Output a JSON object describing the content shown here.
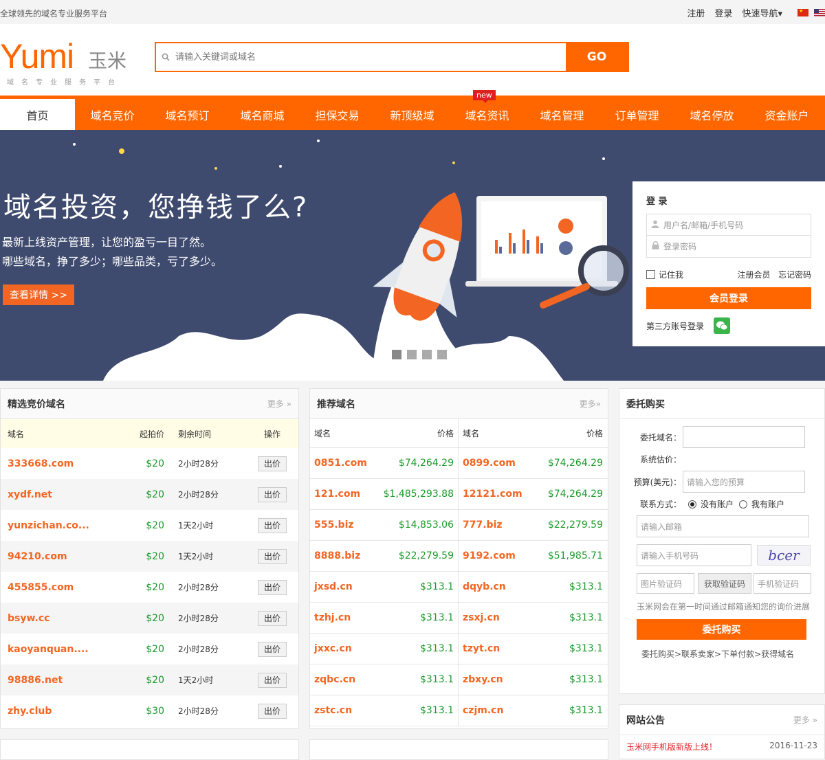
{
  "topbar": {
    "slogan": "全球领先的域名专业服务平台",
    "register": "注册",
    "login": "登录",
    "quicknav": "快速导航"
  },
  "logo": {
    "text": "Yumi",
    "cn": "玉米",
    "sub": "域名专业服务平台"
  },
  "search": {
    "placeholder": "请输入关键词或域名",
    "button": "GO"
  },
  "nav": [
    {
      "label": "首页"
    },
    {
      "label": "域名竞价"
    },
    {
      "label": "域名预订"
    },
    {
      "label": "域名商城"
    },
    {
      "label": "担保交易"
    },
    {
      "label": "新顶级域"
    },
    {
      "label": "域名资讯",
      "tag": "new"
    },
    {
      "label": "域名管理"
    },
    {
      "label": "订单管理"
    },
    {
      "label": "域名停放"
    },
    {
      "label": "资金账户"
    }
  ],
  "banner": {
    "headline": "域名投资，您挣钱了么?",
    "line1": "最新上线资产管理，让您的盈亏一目了然。",
    "line2": "哪些域名，挣了多少；哪些品类，亏了多少。",
    "button": "查看详情 >>"
  },
  "loginbox": {
    "title": "登 录",
    "user_placeholder": "用户名/邮箱/手机号码",
    "pwd_placeholder": "登录密码",
    "remember": "记住我",
    "register": "注册会员",
    "forgot": "忘记密码",
    "submit": "会员登录",
    "third": "第三方账号登录"
  },
  "auction": {
    "title": "精选竞价域名",
    "more": "更多 »",
    "headers": [
      "域名",
      "起拍价",
      "剩余时间",
      "操作"
    ],
    "bid_label": "出价",
    "rows": [
      {
        "name": "333668.com",
        "price": "$20",
        "time": "2小时28分"
      },
      {
        "name": "xydf.net",
        "price": "$20",
        "time": "2小时28分"
      },
      {
        "name": "yunzichan.co...",
        "price": "$20",
        "time": "1天2小时"
      },
      {
        "name": "94210.com",
        "price": "$20",
        "time": "1天2小时"
      },
      {
        "name": "455855.com",
        "price": "$20",
        "time": "2小时28分"
      },
      {
        "name": "bsyw.cc",
        "price": "$20",
        "time": "2小时28分"
      },
      {
        "name": "kaoyanquan....",
        "price": "$20",
        "time": "2小时28分"
      },
      {
        "name": "98886.net",
        "price": "$20",
        "time": "1天2小时"
      },
      {
        "name": "zhy.club",
        "price": "$30",
        "time": "2小时28分"
      }
    ]
  },
  "recommend": {
    "title": "推荐域名",
    "more": "更多»",
    "headers": [
      "域名",
      "价格",
      "域名",
      "价格"
    ],
    "rows": [
      [
        {
          "name": "0851.com",
          "price": "$74,264.29"
        },
        {
          "name": "0899.com",
          "price": "$74,264.29"
        }
      ],
      [
        {
          "name": "121.com",
          "price": "$1,485,293.88"
        },
        {
          "name": "12121.com",
          "price": "$74,264.29"
        }
      ],
      [
        {
          "name": "555.biz",
          "price": "$14,853.06"
        },
        {
          "name": "777.biz",
          "price": "$22,279.59"
        }
      ],
      [
        {
          "name": "8888.biz",
          "price": "$22,279.59"
        },
        {
          "name": "9192.com",
          "price": "$51,985.71"
        }
      ],
      [
        {
          "name": "jxsd.cn",
          "price": "$313.1"
        },
        {
          "name": "dqyb.cn",
          "price": "$313.1"
        }
      ],
      [
        {
          "name": "tzhj.cn",
          "price": "$313.1"
        },
        {
          "name": "zsxj.cn",
          "price": "$313.1"
        }
      ],
      [
        {
          "name": "jxxc.cn",
          "price": "$313.1"
        },
        {
          "name": "tzyt.cn",
          "price": "$313.1"
        }
      ],
      [
        {
          "name": "zqbc.cn",
          "price": "$313.1"
        },
        {
          "name": "zbxy.cn",
          "price": "$313.1"
        }
      ],
      [
        {
          "name": "zstc.cn",
          "price": "$313.1"
        },
        {
          "name": "czjm.cn",
          "price": "$313.1"
        }
      ]
    ]
  },
  "entrust": {
    "title": "委托购买",
    "domain_label": "委托域名：",
    "estimate_label": "系统估价：",
    "budget_label": "预算(美元)：",
    "budget_placeholder": "请输入您的预算",
    "contact_label": "联系方式：",
    "opt_no": "没有账户",
    "opt_yes": "我有账户",
    "email_placeholder": "请输入邮箱",
    "phone_placeholder": "请输入手机号码",
    "captcha_text": "bcer",
    "img_code": "图片验证码",
    "get_code": "获取验证码",
    "phone_code": "手机验证码",
    "notice": "玉米网会在第一时间通过邮箱通知您的询价进展",
    "submit": "委托购买",
    "steps": "委托购买>联系卖家>下单付款>获得域名"
  },
  "notice": {
    "title": "网站公告",
    "more": "更多 »",
    "first_item": "玉米网手机版新版上线！",
    "first_date": "2016-11-23"
  },
  "colors": {
    "accent": "#ff6600",
    "banner": "#3e4a6e",
    "price": "#1a9b2a"
  }
}
